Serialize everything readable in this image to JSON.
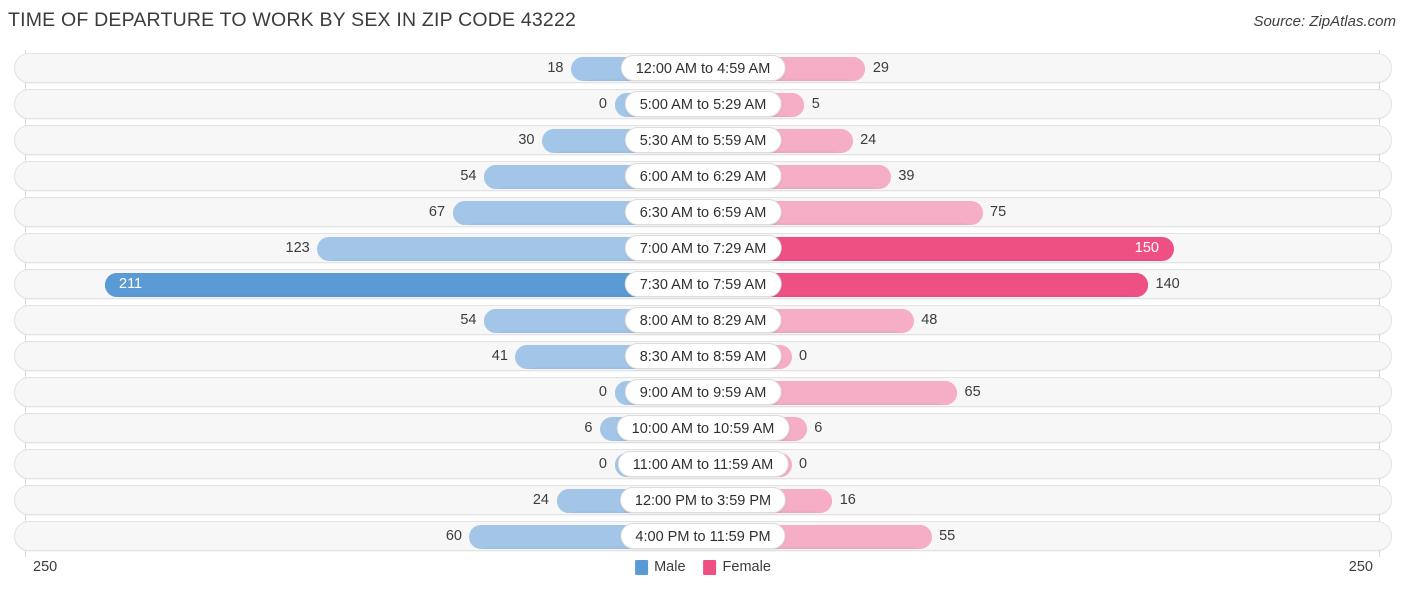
{
  "header": {
    "title": "TIME OF DEPARTURE TO WORK BY SEX IN ZIP CODE 43222",
    "source": "Source: ZipAtlas.com"
  },
  "legend": {
    "items": [
      {
        "label": "Male",
        "color": "#5b9bd5"
      },
      {
        "label": "Female",
        "color": "#ef5084"
      }
    ]
  },
  "axis": {
    "left_max": "250",
    "right_max": "250"
  },
  "colors": {
    "male_dark": "#5b9bd5",
    "male_light": "#a3c6e8",
    "female_dark": "#ef5084",
    "female_light": "#f5aec5",
    "track": "#f7f7f7",
    "track_border": "#e3e3e3",
    "text": "#3c3c3c"
  },
  "chart_data": {
    "type": "bar",
    "title": "TIME OF DEPARTURE TO WORK BY SEX IN ZIP CODE 43222",
    "subtitle": "",
    "orientation": "horizontal-diverging",
    "xlabel": "",
    "ylabel": "",
    "xlim": [
      250,
      250
    ],
    "grid": false,
    "legend_position": "bottom-center",
    "categories": [
      "12:00 AM to 4:59 AM",
      "5:00 AM to 5:29 AM",
      "5:30 AM to 5:59 AM",
      "6:00 AM to 6:29 AM",
      "6:30 AM to 6:59 AM",
      "7:00 AM to 7:29 AM",
      "7:30 AM to 7:59 AM",
      "8:00 AM to 8:29 AM",
      "8:30 AM to 8:59 AM",
      "9:00 AM to 9:59 AM",
      "10:00 AM to 10:59 AM",
      "11:00 AM to 11:59 AM",
      "12:00 PM to 3:59 PM",
      "4:00 PM to 11:59 PM"
    ],
    "series": [
      {
        "name": "Male",
        "values": [
          18,
          0,
          30,
          54,
          67,
          123,
          211,
          54,
          41,
          0,
          6,
          0,
          24,
          60
        ]
      },
      {
        "name": "Female",
        "values": [
          29,
          5,
          24,
          39,
          75,
          150,
          140,
          48,
          0,
          65,
          6,
          0,
          16,
          55
        ]
      }
    ]
  },
  "rows": [
    {
      "category": "12:00 AM to 4:59 AM",
      "male": "18",
      "female": "29",
      "male_inside": false,
      "female_inside": false
    },
    {
      "category": "5:00 AM to 5:29 AM",
      "male": "0",
      "female": "5",
      "male_inside": false,
      "female_inside": false
    },
    {
      "category": "5:30 AM to 5:59 AM",
      "male": "30",
      "female": "24",
      "male_inside": false,
      "female_inside": false
    },
    {
      "category": "6:00 AM to 6:29 AM",
      "male": "54",
      "female": "39",
      "male_inside": false,
      "female_inside": false
    },
    {
      "category": "6:30 AM to 6:59 AM",
      "male": "67",
      "female": "75",
      "male_inside": false,
      "female_inside": false
    },
    {
      "category": "7:00 AM to 7:29 AM",
      "male": "123",
      "female": "150",
      "male_inside": false,
      "female_inside": true
    },
    {
      "category": "7:30 AM to 7:59 AM",
      "male": "211",
      "female": "140",
      "male_inside": true,
      "female_inside": false
    },
    {
      "category": "8:00 AM to 8:29 AM",
      "male": "54",
      "female": "48",
      "male_inside": false,
      "female_inside": false
    },
    {
      "category": "8:30 AM to 8:59 AM",
      "male": "41",
      "female": "0",
      "male_inside": false,
      "female_inside": false
    },
    {
      "category": "9:00 AM to 9:59 AM",
      "male": "0",
      "female": "65",
      "male_inside": false,
      "female_inside": false
    },
    {
      "category": "10:00 AM to 10:59 AM",
      "male": "6",
      "female": "6",
      "male_inside": false,
      "female_inside": false
    },
    {
      "category": "11:00 AM to 11:59 AM",
      "male": "0",
      "female": "0",
      "male_inside": false,
      "female_inside": false
    },
    {
      "category": "12:00 PM to 3:59 PM",
      "male": "24",
      "female": "16",
      "male_inside": false,
      "female_inside": false
    },
    {
      "category": "4:00 PM to 11:59 PM",
      "male": "60",
      "female": "55",
      "male_inside": false,
      "female_inside": false
    }
  ]
}
